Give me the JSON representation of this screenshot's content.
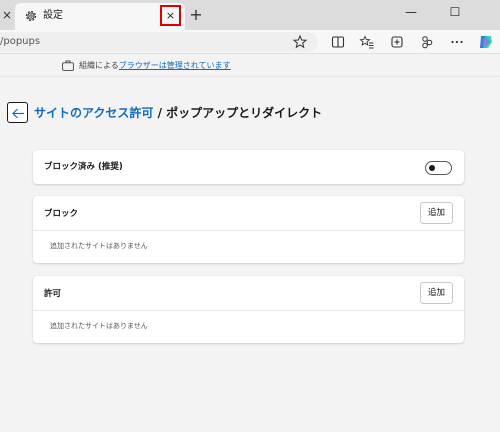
{
  "browser": {
    "prev_tab_close": "×",
    "tab": {
      "title": "設定",
      "close": "×"
    },
    "new_tab": "+",
    "window": {
      "minimize": "—",
      "maximize": "☐"
    },
    "address": "/popups"
  },
  "managed_bar": {
    "prefix": "組織による",
    "link": "ブラウザーは管理されています"
  },
  "header": {
    "parent": "サイトのアクセス許可",
    "separator": " / ",
    "current": "ポップアップとリダイレクト"
  },
  "blocked_toggle": {
    "label": "ブロック済み (推奨)",
    "enabled": false
  },
  "block_section": {
    "title": "ブロック",
    "add_label": "追加",
    "empty_text": "追加されたサイトはありません"
  },
  "allow_section": {
    "title": "許可",
    "add_label": "追加",
    "empty_text": "追加されたサイトはありません"
  },
  "colors": {
    "accent": "#0f6cbd",
    "highlight": "#e00000"
  }
}
